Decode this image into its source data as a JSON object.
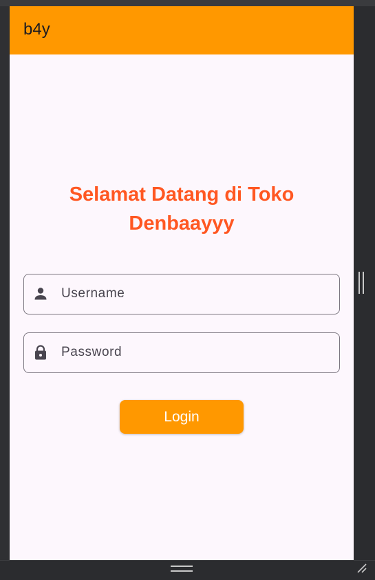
{
  "appbar": {
    "title": "b4y",
    "color": "#ff9800"
  },
  "main": {
    "welcome_line1": "Selamat Datang di Toko",
    "welcome_line2": "Denbaayyy",
    "welcome_color": "#ff5722"
  },
  "form": {
    "username": {
      "placeholder": "Username",
      "value": "",
      "icon": "person-icon"
    },
    "password": {
      "placeholder": "Password",
      "value": "",
      "icon": "lock-icon"
    },
    "login_label": "Login"
  },
  "colors": {
    "accent": "#ff9800",
    "background": "#fdf7fd",
    "frame": "#2b2c2f"
  }
}
